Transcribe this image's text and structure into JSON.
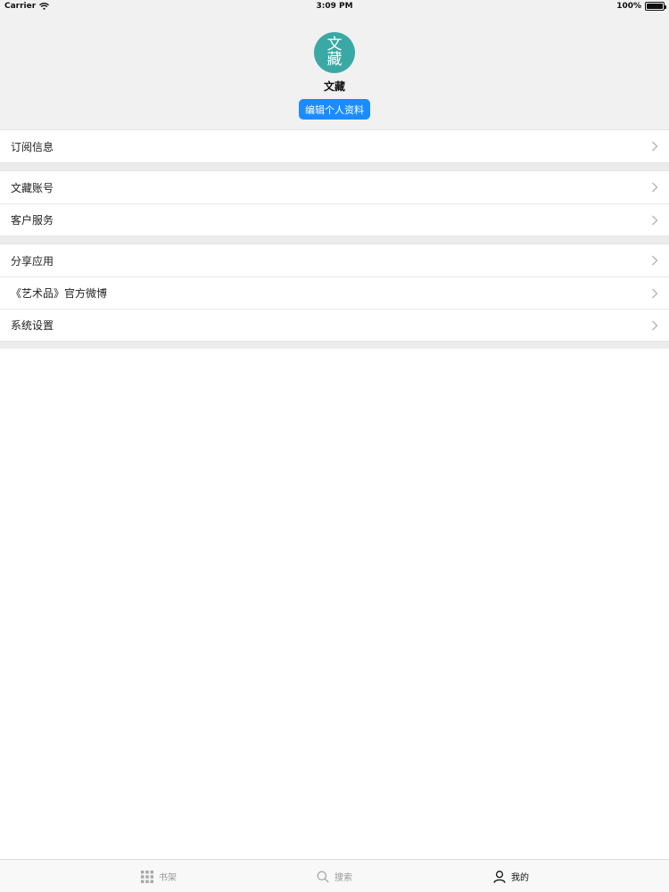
{
  "status_bar": {
    "carrier": "Carrier",
    "time": "3:09 PM",
    "battery": "100%",
    "battery_level": 1.0
  },
  "profile": {
    "avatar_text_line1": "文",
    "avatar_text_line2": "藏",
    "avatar_color": "#3aa9a5",
    "name": "文藏",
    "edit_button_label": "编辑个人资料",
    "accent_color": "#1a8cff"
  },
  "menu": {
    "group1": [
      {
        "label": "订阅信息"
      }
    ],
    "group2": [
      {
        "label": "文藏账号"
      },
      {
        "label": "客户服务"
      }
    ],
    "group3": [
      {
        "label": "分享应用"
      },
      {
        "label": "《艺术品》官方微博"
      },
      {
        "label": "系统设置"
      }
    ],
    "chevron_icon": "chevron-right-icon"
  },
  "tab_bar": {
    "tabs": [
      {
        "label": "书架",
        "icon": "grid-icon",
        "selected": false
      },
      {
        "label": "搜索",
        "icon": "search-icon",
        "selected": false
      },
      {
        "label": "我的",
        "icon": "user-icon",
        "selected": true
      }
    ]
  }
}
